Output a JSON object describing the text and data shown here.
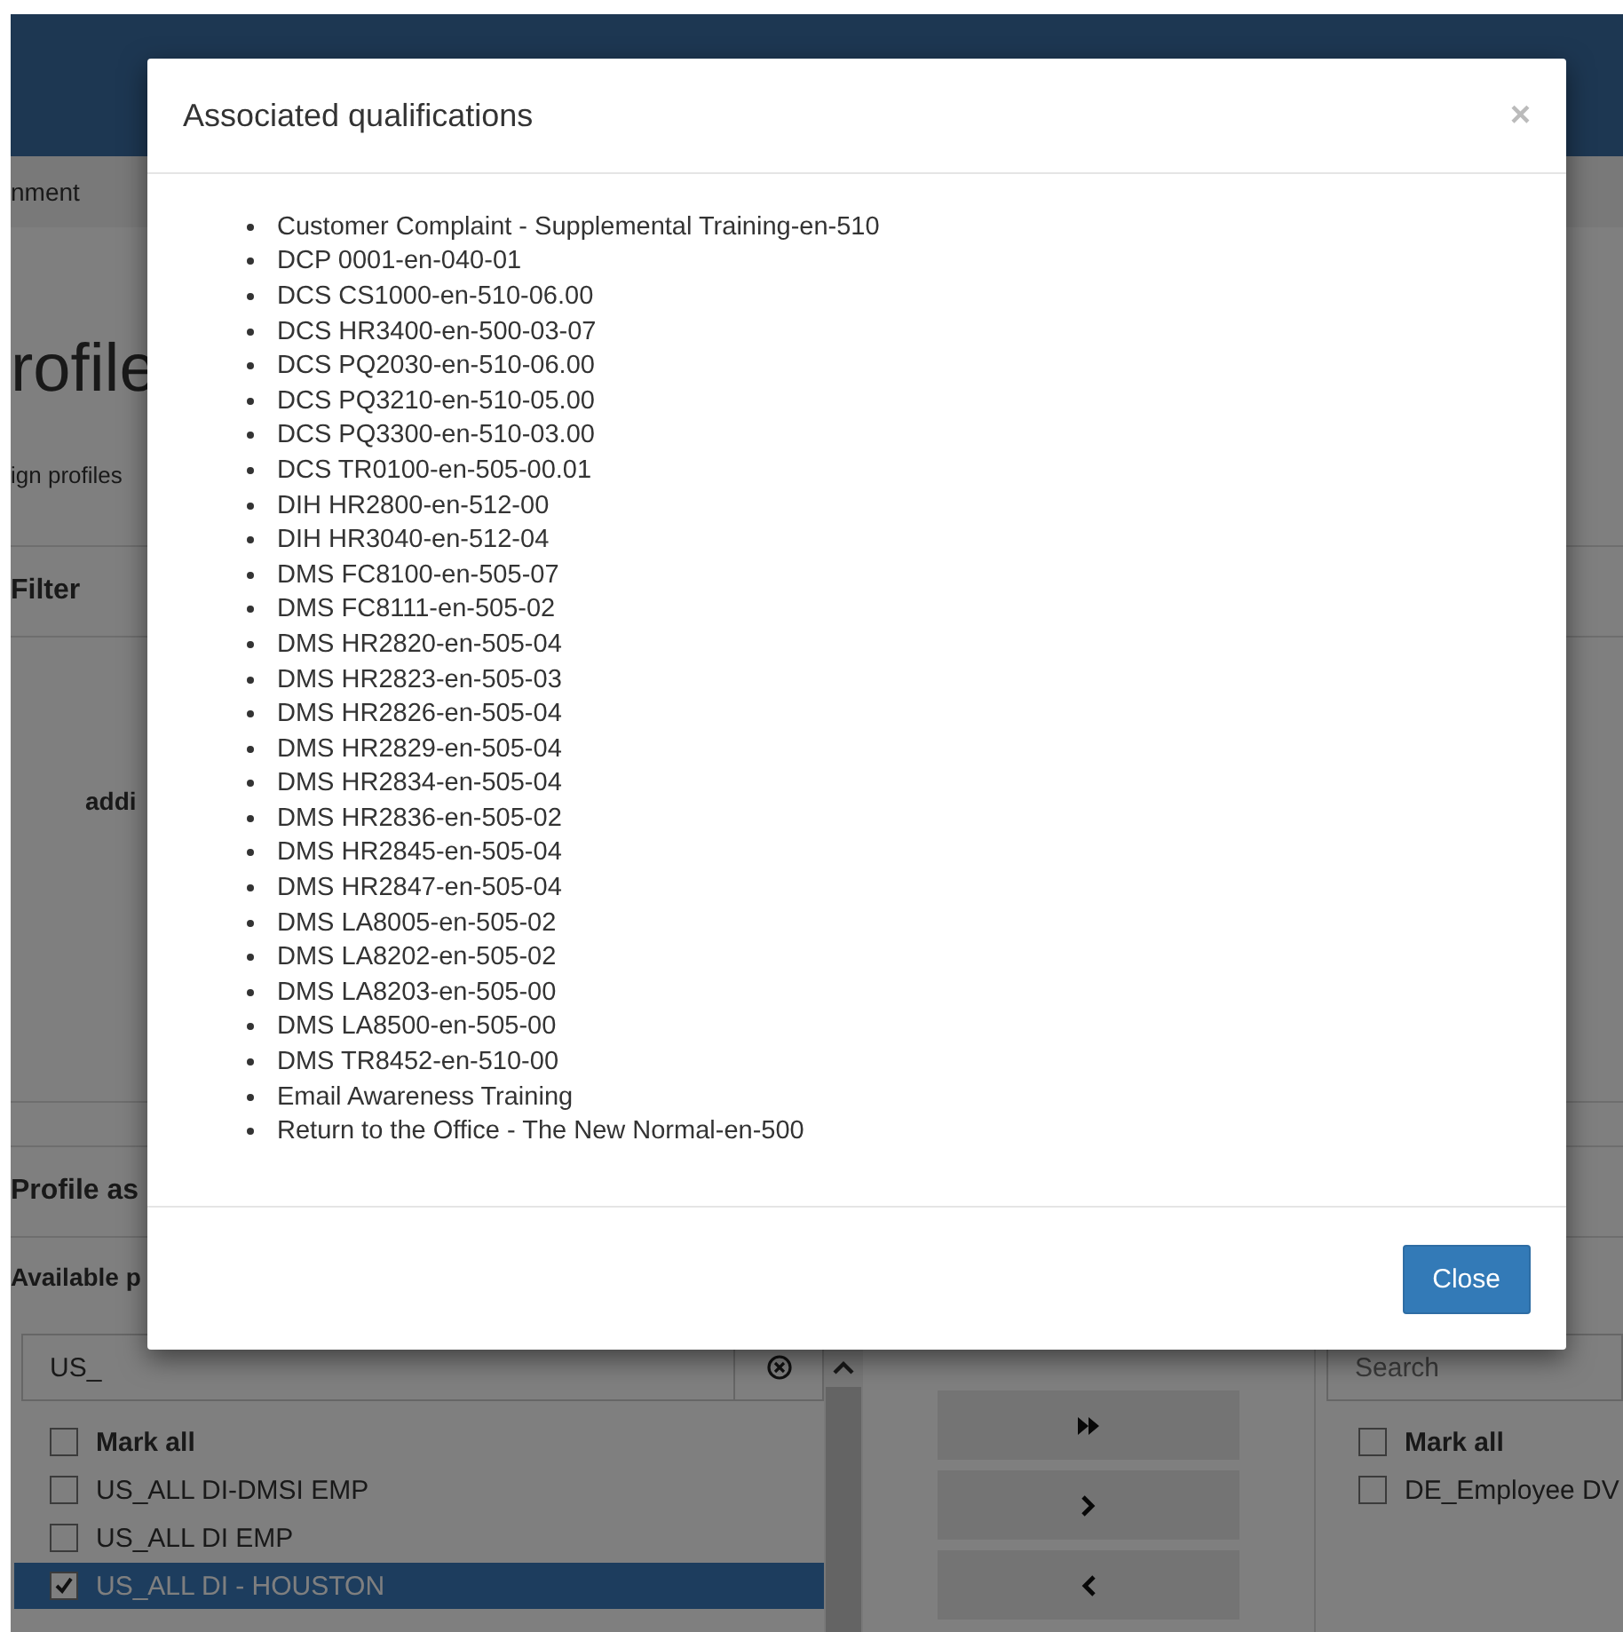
{
  "background": {
    "nav_item": "nment",
    "page_title": "rofile",
    "subtitle": "ign profiles",
    "filter_panel": {
      "title": "Filter",
      "field_label": "addi"
    },
    "assignment_panel": {
      "title": "Profile as",
      "available_label": "Available p"
    },
    "available": {
      "search_value": "US_",
      "mark_all": {
        "label": "Mark all",
        "checked": false
      },
      "items": [
        {
          "label": "US_ALL DI-DMSI EMP",
          "checked": false,
          "selected": false
        },
        {
          "label": "US_ALL DI EMP",
          "checked": false,
          "selected": false
        },
        {
          "label": "US_ALL DI - HOUSTON",
          "checked": true,
          "selected": true
        }
      ]
    },
    "assigned": {
      "search_placeholder": "Search",
      "mark_all": {
        "label": "Mark all",
        "checked": false
      },
      "items": [
        {
          "label": "DE_Employee DV",
          "checked": false,
          "selected": false
        }
      ]
    }
  },
  "dialog": {
    "title": "Associated qualifications",
    "close_symbol": "×",
    "items": [
      "Customer Complaint - Supplemental Training-en-510",
      "DCP 0001-en-040-01",
      "DCS CS1000-en-510-06.00",
      "DCS HR3400-en-500-03-07",
      "DCS PQ2030-en-510-06.00",
      "DCS PQ3210-en-510-05.00",
      "DCS PQ3300-en-510-03.00",
      "DCS TR0100-en-505-00.01",
      "DIH HR2800-en-512-00",
      "DIH HR3040-en-512-04",
      "DMS FC8100-en-505-07",
      "DMS FC8111-en-505-02",
      "DMS HR2820-en-505-04",
      "DMS HR2823-en-505-03",
      "DMS HR2826-en-505-04",
      "DMS HR2829-en-505-04",
      "DMS HR2834-en-505-04",
      "DMS HR2836-en-505-02",
      "DMS HR2845-en-505-04",
      "DMS HR2847-en-505-04",
      "DMS LA8005-en-505-02",
      "DMS LA8202-en-505-02",
      "DMS LA8203-en-505-00",
      "DMS LA8500-en-505-00",
      "DMS TR8452-en-510-00",
      "Email Awareness Training",
      "Return to the Office - The New Normal-en-500"
    ],
    "buttons": [
      "Close"
    ]
  }
}
